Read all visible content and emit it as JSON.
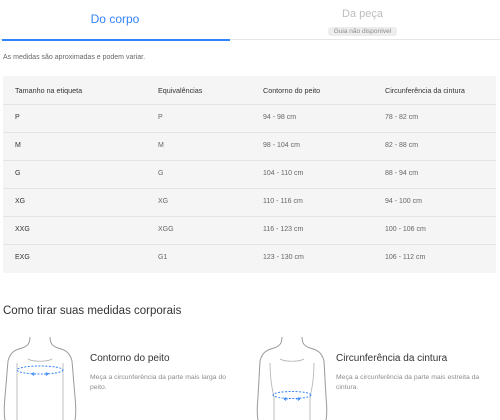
{
  "tabs": [
    {
      "label": "Do corpo",
      "active": true
    },
    {
      "label": "Da peça",
      "badge": "Guia não disponível",
      "disabled": true
    }
  ],
  "note": "As medidas são aproximadas e podem variar.",
  "table": {
    "headers": [
      "Tamanho na etiqueta",
      "Equivalências",
      "Contorno do peito",
      "Circunferência da cintura"
    ],
    "rows": [
      [
        "P",
        "P",
        "94 - 98 cm",
        "78 - 82 cm"
      ],
      [
        "M",
        "M",
        "98 - 104 cm",
        "82 - 88 cm"
      ],
      [
        "G",
        "G",
        "104 - 110 cm",
        "88 - 94 cm"
      ],
      [
        "XG",
        "XG",
        "110 - 116 cm",
        "94 - 100 cm"
      ],
      [
        "XXG",
        "XGG",
        "116 - 123 cm",
        "100 - 106 cm"
      ],
      [
        "EXG",
        "G1",
        "123 - 130 cm",
        "106 - 112 cm"
      ]
    ]
  },
  "guide": {
    "title": "Como tirar suas medidas corporais",
    "items": [
      {
        "title": "Contorno do peito",
        "description": "Meça a circunferência da parte mais larga do peito.",
        "icon": "chest-measure-illustration"
      },
      {
        "title": "Circunferência da cintura",
        "description": "Meça a circunferência da parte mais estreita da cintura.",
        "icon": "waist-measure-illustration"
      }
    ]
  },
  "colors": {
    "accent": "#3483fa",
    "table_bg": "#f5f5f5",
    "muted": "#bdbdbd"
  }
}
